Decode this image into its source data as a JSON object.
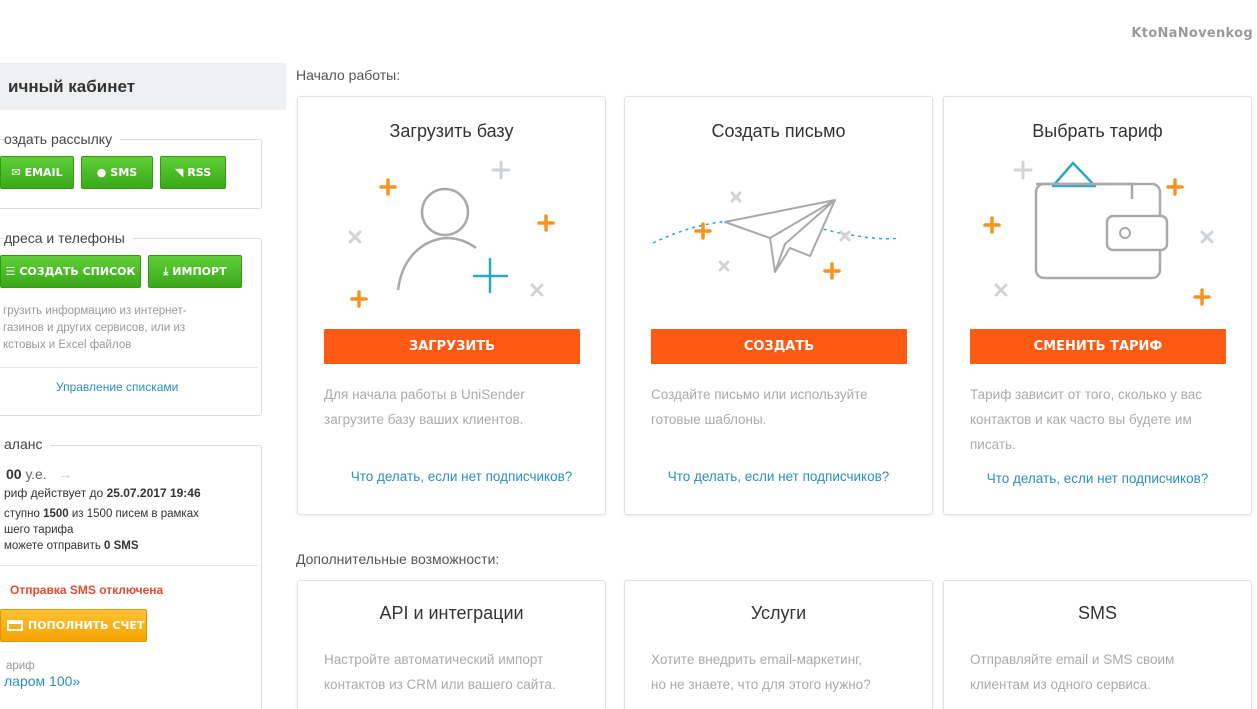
{
  "watermark": "KtoNaNovenkog",
  "sidebar": {
    "title": "ичный кабинет",
    "send": {
      "legend": "оздать рассылку",
      "buttons": {
        "email": "EMAIL",
        "sms": "SMS",
        "rss": "RSS"
      }
    },
    "contacts": {
      "legend": "дреса и телефоны",
      "create_list": "СОЗДАТЬ СПИСОК",
      "import": "ИМПОРТ",
      "description": [
        "грузить информацию из интернет-",
        "газинов и других сервисов, или из",
        "кстовых и Excel файлов"
      ],
      "manage_link": "Управление списками"
    },
    "balance": {
      "legend": "аланс",
      "amount": "00",
      "currency": "у.е.",
      "tariff_prefix": "риф действует до ",
      "tariff_until": "25.07.2017 19:46",
      "avail_prefix": "ступно ",
      "avail_count": "1500",
      "avail_mid": " из 1500 писем в рамках",
      "avail_line2": "шего тарифа",
      "sms_prefix": " можете отправить ",
      "sms_count": "0 SMS",
      "sms_disabled": "Отправка SMS отключена",
      "topup": "ПОПОЛНИТЬ СЧЕТ",
      "tariff_label": "ариф",
      "tariff_name": "ларом 100»"
    }
  },
  "main": {
    "start_label": "Начало работы:",
    "cards": [
      {
        "title": "Загрузить базу",
        "button": "ЗАГРУЗИТЬ",
        "desc1": "Для начала работы в UniSender",
        "desc2": "загрузите базу ваших клиентов.",
        "link": "Что делать, если нет подписчиков?"
      },
      {
        "title": "Создать письмо",
        "button": "СОЗДАТЬ",
        "desc1": "Создайте письмо или используйте",
        "desc2": "готовые шаблоны.",
        "link": "Что делать, если нет подписчиков?"
      },
      {
        "title": "Выбрать тариф",
        "button": "СМЕНИТЬ ТАРИФ",
        "desc1": "Тариф зависит от того, сколько у вас",
        "desc2": "контактов и как часто вы будете им",
        "desc3": "писать.",
        "link": "Что делать, если нет подписчиков?"
      }
    ],
    "extra_label": "Дополнительные возможности:",
    "extra_cards": [
      {
        "title": "API и интеграции",
        "desc1": "Настройте автоматический импорт",
        "desc2": "контактов из CRM или вашего сайта."
      },
      {
        "title": "Услуги",
        "desc1": "Хотите внедрить email-маркетинг,",
        "desc2": "но не знаете, что для этого нужно?"
      },
      {
        "title": "SMS",
        "desc1": "Отправляйте email и SMS своим",
        "desc2": "клиентам из одного сервиса."
      }
    ]
  },
  "colors": {
    "accent_orange": "#ff5a14",
    "green": "#3aa81a",
    "link": "#2a8fbd",
    "icon_orange": "#f7931e",
    "icon_blue": "#2aa7c9"
  },
  "icons": [
    "email-icon",
    "sms-icon",
    "rss-icon",
    "list-icon",
    "import-icon",
    "card-icon",
    "arrow-right-icon",
    "user-icon",
    "plane-icon",
    "wallet-icon"
  ]
}
